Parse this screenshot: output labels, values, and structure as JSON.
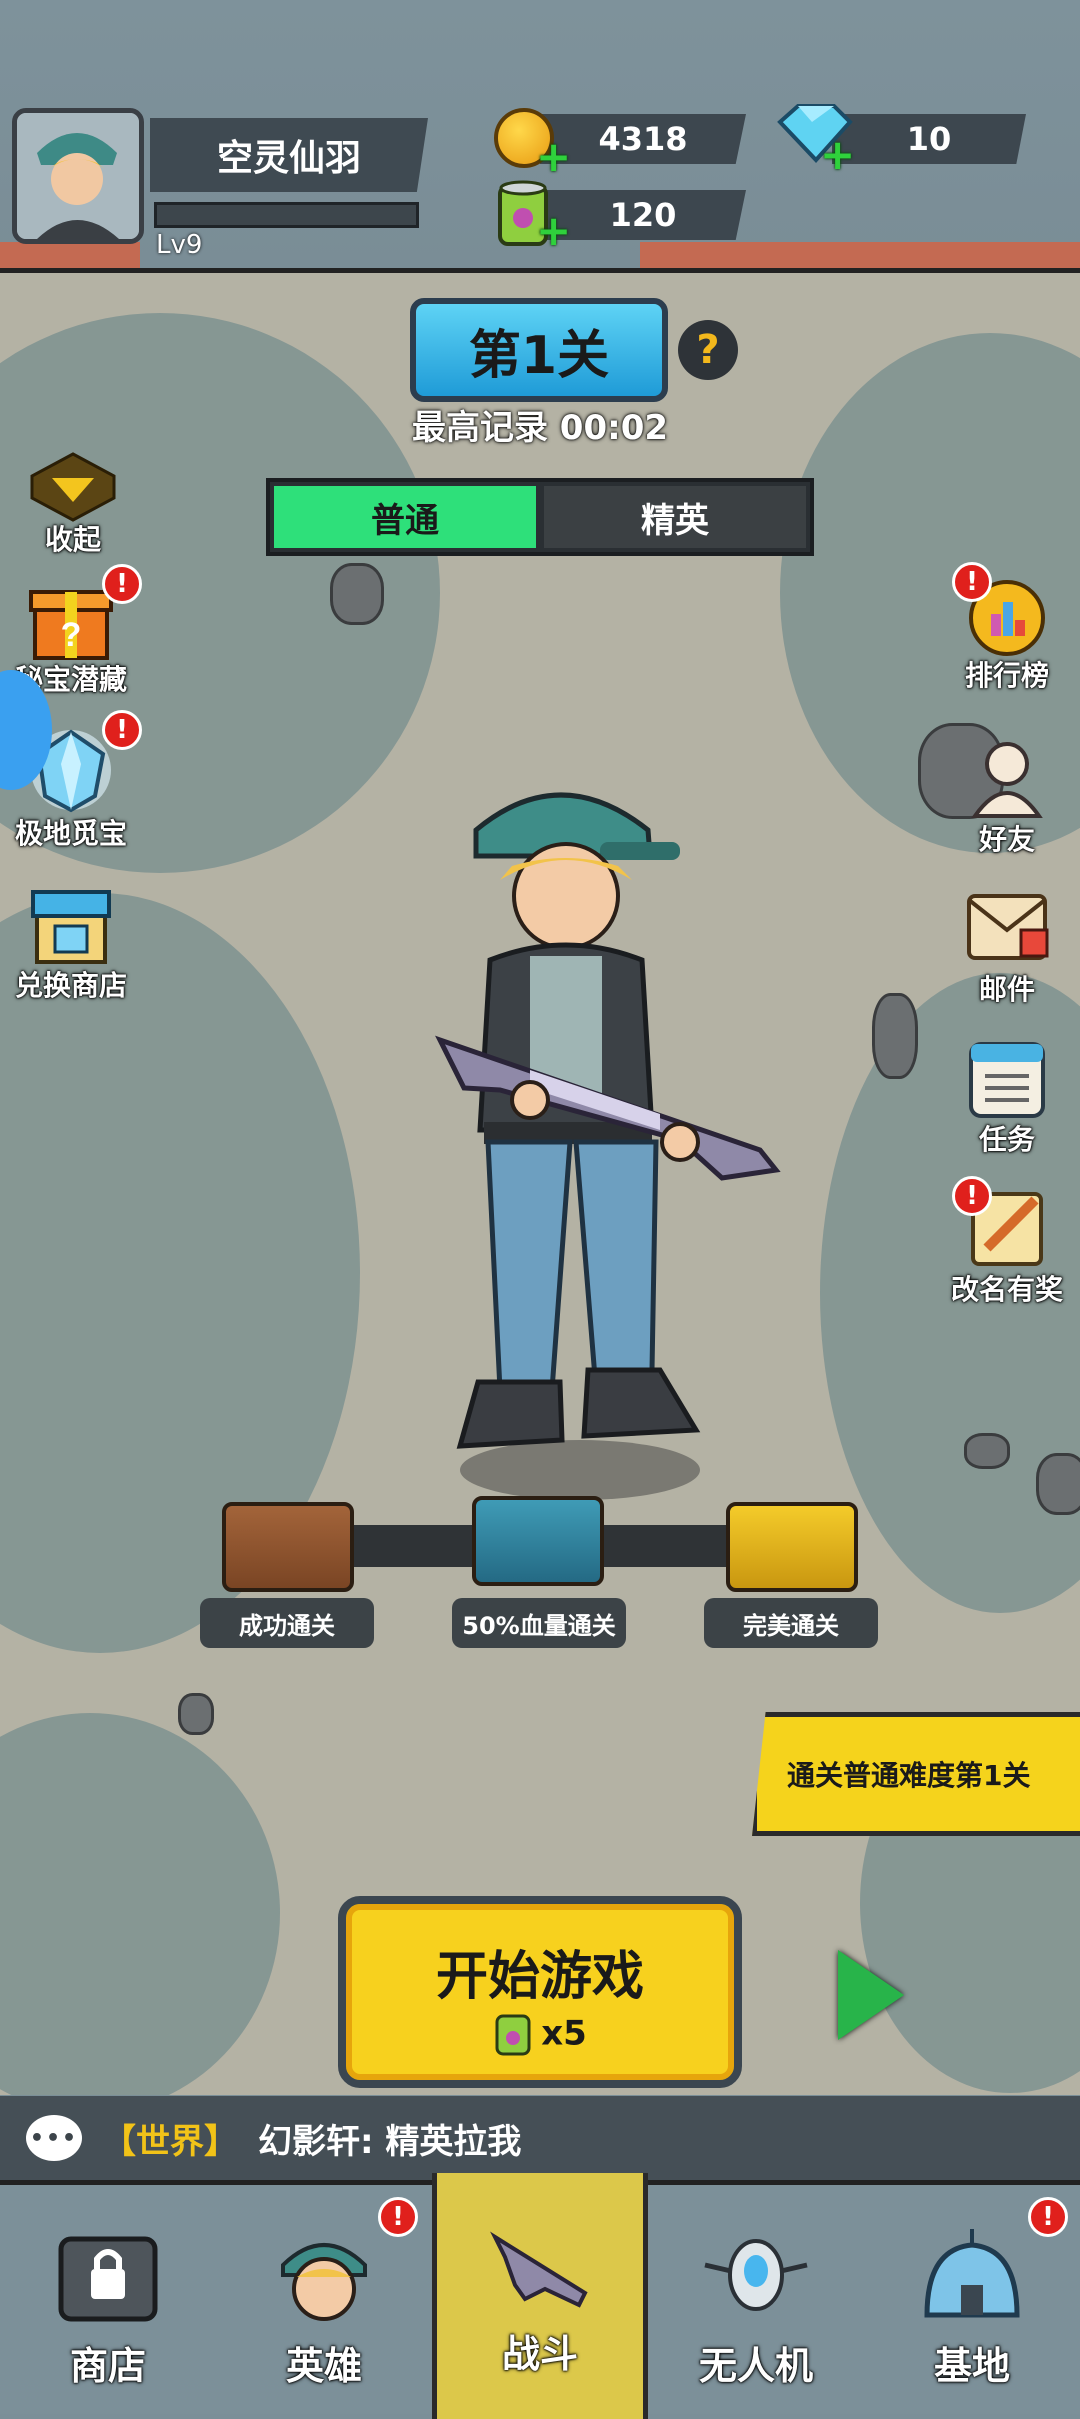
{
  "player": {
    "name": "空灵仙羽",
    "level": "Lv9"
  },
  "resources": {
    "gold": "4318",
    "diamonds": "10",
    "energy": "120"
  },
  "stage": {
    "title": "第1关",
    "help": "?",
    "record": "最高记录 00:02",
    "modes": [
      "普通",
      "精英"
    ]
  },
  "left_menu": {
    "collapse": "收起",
    "items": [
      "秘宝潜藏",
      "极地觅宝",
      "兑换商店"
    ]
  },
  "right_menu": {
    "items": [
      "排行榜",
      "好友",
      "邮件",
      "任务",
      "改名有奖"
    ]
  },
  "chests": [
    "成功通关",
    "50%血量通关",
    "完美通关"
  ],
  "quest_banner": "通关普通难度第1关",
  "start": {
    "title": "开始游戏",
    "cost": "x5"
  },
  "chat": {
    "channel": "【世界】",
    "message": "幻影轩: 精英拉我"
  },
  "nav": {
    "items": [
      "商店",
      "英雄",
      "战斗",
      "无人机",
      "基地"
    ],
    "active": "战斗"
  },
  "alert_mark": "!"
}
